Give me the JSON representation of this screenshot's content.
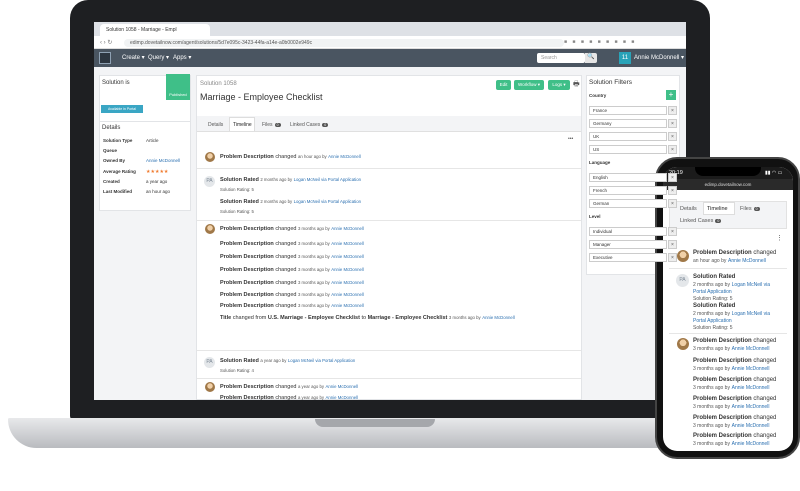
{
  "browser": {
    "tab_title": "Solution 1058 - Marriage - Empl",
    "url": "edimp.dovetailnow.com/agent/solutions/5d7e095c-3423-44fa-a14e-a0b0002e949c"
  },
  "appbar": {
    "create": "Create ▾",
    "query": "Query ▾",
    "apps": "Apps ▾",
    "search_placeholder": "Search",
    "search_icon": "🔍",
    "count": "11",
    "user": "Annie McDonnell ▾"
  },
  "left": {
    "solution_is": "Solution is",
    "published": "Published",
    "portal_btn": "Available in Portal",
    "details_title": "Details",
    "fields": [
      {
        "k": "Solution Type",
        "v": "Article"
      },
      {
        "k": "Queue",
        "v": ""
      },
      {
        "k": "Owned By",
        "v": "Annie McDonnell"
      },
      {
        "k": "Average Rating",
        "v": "★★★★★"
      },
      {
        "k": "Created",
        "v": "a year ago"
      },
      {
        "k": "Last Modified",
        "v": "an hour ago"
      }
    ]
  },
  "center": {
    "number": "Solution 1058",
    "title": "Marriage - Employee Checklist",
    "edit": "Edit",
    "workflow": "Workflow ▾",
    "logs": "Logs ▾",
    "print_icon": "🖶",
    "tabs": {
      "details": "Details",
      "timeline": "Timeline",
      "files": "Files",
      "files_count": "0",
      "linked": "Linked Cases",
      "linked_count": "0"
    },
    "more": "•••",
    "e1": {
      "title": "Problem Description",
      "verb": "changed",
      "time": "an hour ago by",
      "by": "Annie McDonnell"
    },
    "pa_initials": "PA",
    "e2": {
      "title": "Solution Rated",
      "time": "2 months ago by",
      "by": "Logan McNeil via Portal Application",
      "sub": "Solution Rating: 5"
    },
    "e3": {
      "title": "Solution Rated",
      "time": "2 months ago by",
      "by": "Logan McNeil via Portal Application",
      "sub": "Solution Rating: 5"
    },
    "pd": {
      "title": "Problem Description",
      "verb": "changed",
      "time": "3 months ago by",
      "by": "Annie McDonnell"
    },
    "title_change": {
      "pre": "Title",
      "changed_from": "changed from",
      "from": "U.S. Marriage - Employee Checklist",
      "to_word": "to",
      "to": "Marriage - Employee Checklist",
      "time": "3 months ago by",
      "by": "Annie McDonnell"
    },
    "e4": {
      "title": "Solution Rated",
      "time": "a year ago by",
      "by": "Logan McNeil via Portal Application",
      "sub": "Solution Rating: 4"
    },
    "e5": {
      "title": "Problem Description",
      "verb": "changed",
      "time": "a year ago by",
      "by": "Annie McDonnell"
    },
    "e6": {
      "title": "Problem Description",
      "verb": "changed",
      "time": "a year ago by",
      "by": "Annie McDonnell"
    }
  },
  "filters": {
    "title": "Solution Filters",
    "country": "Country",
    "countries": [
      "France",
      "Germany",
      "UK",
      "US"
    ],
    "language": "Language",
    "languages": [
      "English",
      "French",
      "German"
    ],
    "level": "Level",
    "levels": [
      "Individual",
      "Manager",
      "Executive"
    ],
    "plus": "+",
    "x": "×"
  },
  "phone": {
    "time": "20:19",
    "signal": "▮▮ ◠ ▭",
    "url": "edimp.dovetailnow.com",
    "tabs": {
      "details": "Details",
      "timeline": "Timeline",
      "files": "Files",
      "files_count": "0",
      "linked": "Linked Cases",
      "linked_count": "0"
    },
    "more": "⋮",
    "e1": {
      "title": "Problem Description",
      "verb": "changed",
      "time": "an hour ago by",
      "by": "Annie McDonnell"
    },
    "e2": {
      "title": "Solution Rated",
      "time": "2 months ago by",
      "by": "Logan McNeil via Portal Application",
      "sub": "Solution Rating: 5"
    },
    "pd": {
      "title": "Problem Description",
      "verb": "changed",
      "time": "3 months ago by",
      "by": "Annie McDonnell"
    }
  }
}
